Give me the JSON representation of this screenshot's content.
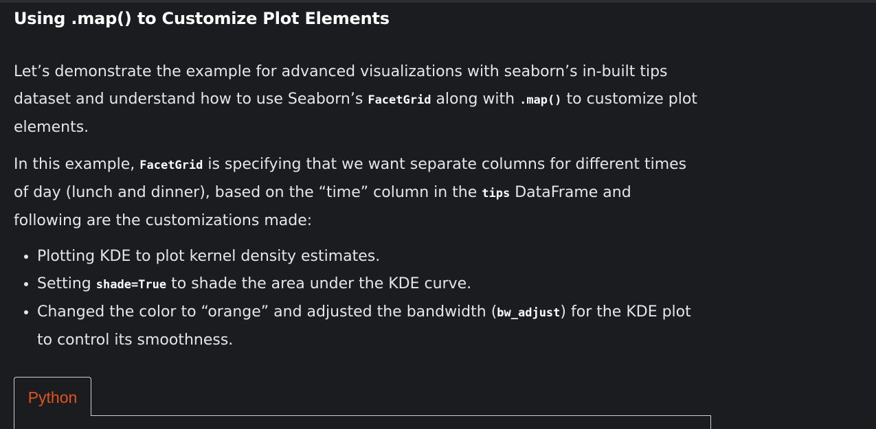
{
  "article": {
    "heading": "Using .map() to Customize Plot Elements",
    "para1": {
      "t1": "Let’s demonstrate the example for advanced visualizations with seaborn’s in-built tips dataset and understand how to use Seaborn’s ",
      "c1": "FacetGrid",
      "t2": " along with ",
      "c2": ".map()",
      "t3": " to customize plot elements."
    },
    "para2": {
      "t1": "In this example, ",
      "c1": "FacetGrid",
      "t2": " is specifying that we want separate columns for different times of day (lunch and dinner), based on the “time” column in the ",
      "c2": "tips",
      "t3": " DataFrame and following are the customizations made:"
    },
    "bullets": {
      "b1": "Plotting KDE to plot kernel density estimates.",
      "b2_t1": "Setting ",
      "b2_c1": "shade=True",
      "b2_t2": " to shade the area under the KDE curve.",
      "b3_t1": "Changed the color to “orange” and adjusted the bandwidth (",
      "b3_c1": "bw_adjust",
      "b3_t2": ") for the KDE plot to control its smoothness."
    }
  },
  "code_tabs": {
    "active_tab": "Python",
    "accent_color": "#e2531d"
  }
}
